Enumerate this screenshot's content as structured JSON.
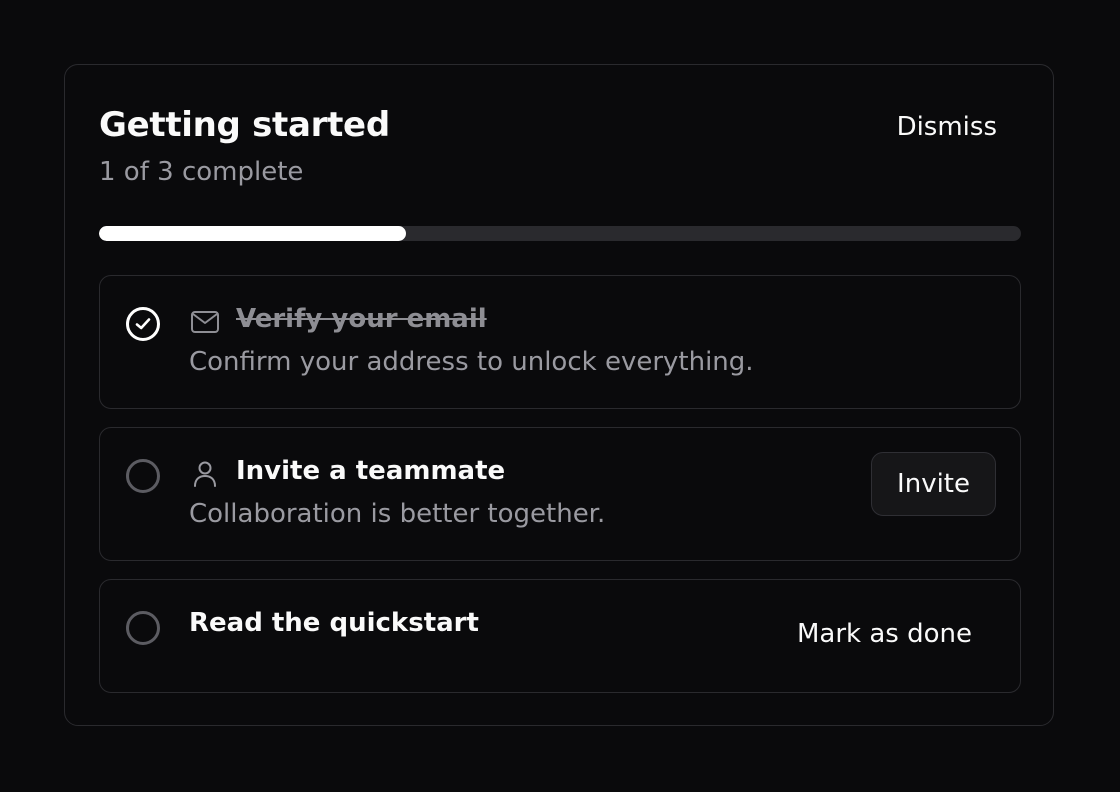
{
  "card": {
    "title": "Getting started",
    "subtitle": "1 of 3 complete",
    "dismiss_label": "Dismiss",
    "progress_fraction": 0.333
  },
  "tasks": [
    {
      "title": "Verify your email",
      "description": "Confirm your address to unlock everything.",
      "icon": "mail-icon",
      "completed": true
    },
    {
      "title": "Invite a teammate",
      "description": "Collaboration is better together.",
      "icon": "user-icon",
      "completed": false,
      "action_label": "Invite"
    },
    {
      "title": "Read the quickstart",
      "completed": false,
      "action_label": "Mark as done"
    }
  ],
  "colors": {
    "background": "#0a0a0c",
    "border": "#2a2a2e",
    "progress_fill": "#ffffff",
    "progress_track": "#2a2a2e",
    "muted_text": "#9a9aa1"
  }
}
